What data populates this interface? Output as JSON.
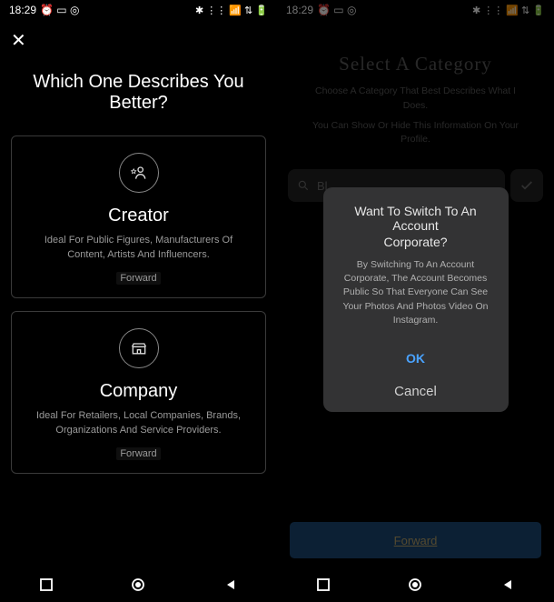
{
  "statusbar": {
    "time": "18:29",
    "icons_left": "⏰ ▭ ◎",
    "icons_right": "✱ ⋮⋮ 📶 ⇅ 🔋"
  },
  "left": {
    "title": "Which One Describes You Better?",
    "cards": [
      {
        "title": "Creator",
        "desc": "Ideal For Public Figures, Manufacturers Of Content, Artists And Influencers.",
        "forward": "Forward"
      },
      {
        "title": "Company",
        "desc": "Ideal For Retailers, Local Companies, Brands, Organizations And Service Providers.",
        "forward": "Forward"
      }
    ]
  },
  "right": {
    "title": "Select A Category",
    "subtitle1": "Choose A Category That Best Describes What I Does.",
    "subtitle2": "You Can Show Or Hide This Information On Your Profile.",
    "search_placeholder": "Bl",
    "dialog": {
      "title_line1": "Want To Switch To An Account",
      "title_line2": "Corporate?",
      "body": "By Switching To An Account Corporate, The Account Becomes Public So That Everyone Can See Your Photos And Photos Video On Instagram.",
      "ok": "OK",
      "cancel": "Cancel"
    },
    "forward": "Forward"
  }
}
